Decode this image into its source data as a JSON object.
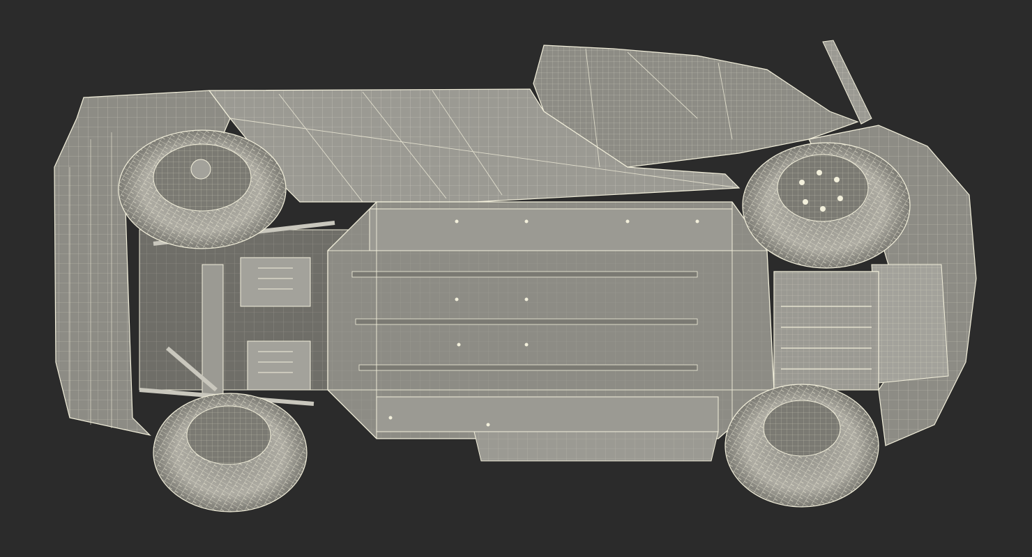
{
  "scene": {
    "subject": "car-underside-wireframe",
    "colors": {
      "background": "#2b2b2b",
      "body": "#8d8c85",
      "body_dark": "#6f6e68",
      "body_light": "#a3a29b",
      "wire": "#f3f0dc",
      "tire": "#b9b7ad",
      "tire_dark": "#7b7a73",
      "shadow": "#55544f"
    }
  }
}
